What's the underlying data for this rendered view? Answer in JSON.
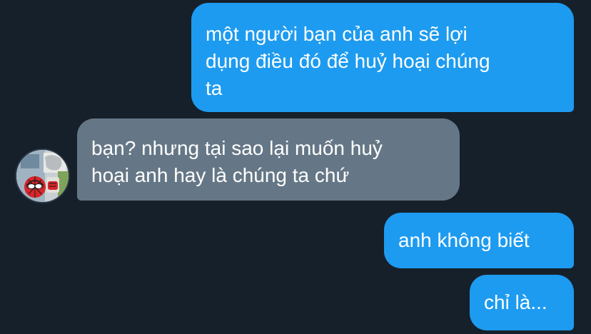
{
  "messages": [
    {
      "side": "outgoing",
      "text": "một người bạn của anh sẽ lợi dụng điều đó để huỷ hoại chúng ta"
    },
    {
      "side": "incoming",
      "text": "bạn? nhưng tại sao lại muốn huỷ hoại anh hay là chúng ta chứ"
    },
    {
      "side": "outgoing",
      "text": "anh không biết"
    },
    {
      "side": "outgoing",
      "text": "chỉ là..."
    }
  ],
  "display": {
    "messages": [
      "một người bạn của anh sẽ lợi\ndụng điều đó để huỷ hoại chúng\nta",
      "bạn? nhưng tại sao lại muốn huỷ\nhoại anh hay là chúng ta chứ",
      "anh không biết",
      "chỉ là..."
    ]
  },
  "colors": {
    "background": "#16202b",
    "outgoing_bubble": "#1d9bf0",
    "incoming_bubble": "#657786",
    "text": "#ffffff"
  },
  "avatar": {
    "icon": "spiderman-comic-avatar-icon"
  }
}
